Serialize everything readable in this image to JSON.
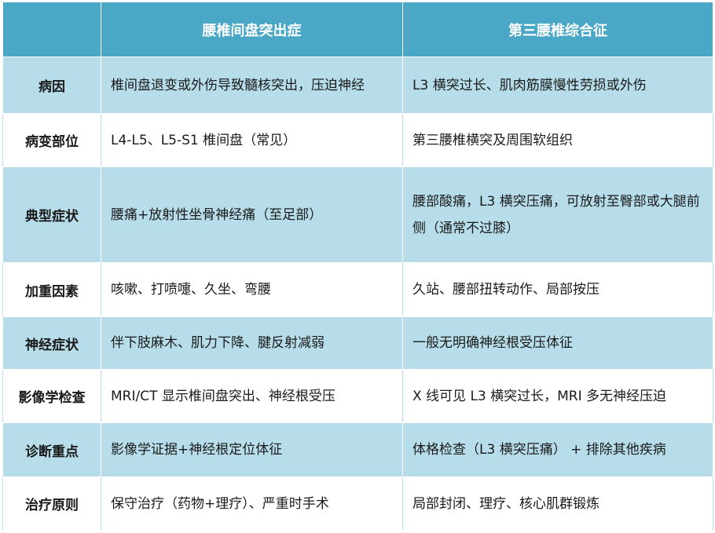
{
  "header": {
    "corner": "",
    "col1": "腰椎间盘突出症",
    "col2": "第三腰椎综合征"
  },
  "rows": [
    {
      "label": "病因",
      "col1": "椎间盘退变或外伤导致髓核突出，压迫神经",
      "col2": "L3 横突过长、肌肉筋膜慢性劳损或外伤"
    },
    {
      "label": "病变部位",
      "col1": "L4-L5、L5-S1 椎间盘（常见）",
      "col2": "第三腰椎横突及周围软组织"
    },
    {
      "label": "典型症状",
      "col1": "腰痛+放射性坐骨神经痛（至足部）",
      "col2": "腰部酸痛，L3 横突压痛，可放射至臀部或大腿前侧（通常不过膝）"
    },
    {
      "label": "加重因素",
      "col1": "咳嗽、打喷嚏、久坐、弯腰",
      "col2": "久站、腰部扭转动作、局部按压"
    },
    {
      "label": "神经症状",
      "col1": "伴下肢麻木、肌力下降、腱反射减弱",
      "col2": "一般无明确神经根受压体征"
    },
    {
      "label": "影像学检查",
      "col1": "MRI/CT 显示椎间盘突出、神经根受压",
      "col2": "X 线可见 L3 横突过长，MRI 多无神经压迫"
    },
    {
      "label": "诊断重点",
      "col1": "影像学证据+神经根定位体征",
      "col2": "体格检查（L3 横突压痛） + 排除其他疾病"
    },
    {
      "label": "治疗原则",
      "col1": "保守治疗（药物+理疗）、严重时手术",
      "col2": "局部封闭、理疗、核心肌群锻炼"
    }
  ],
  "colors": {
    "header_bg": "#4aa8c6",
    "stripe_bg": "#b6dde9",
    "plain_bg": "#ffffff",
    "header_text": "#ffffff",
    "body_text": "#1a1a1a"
  }
}
